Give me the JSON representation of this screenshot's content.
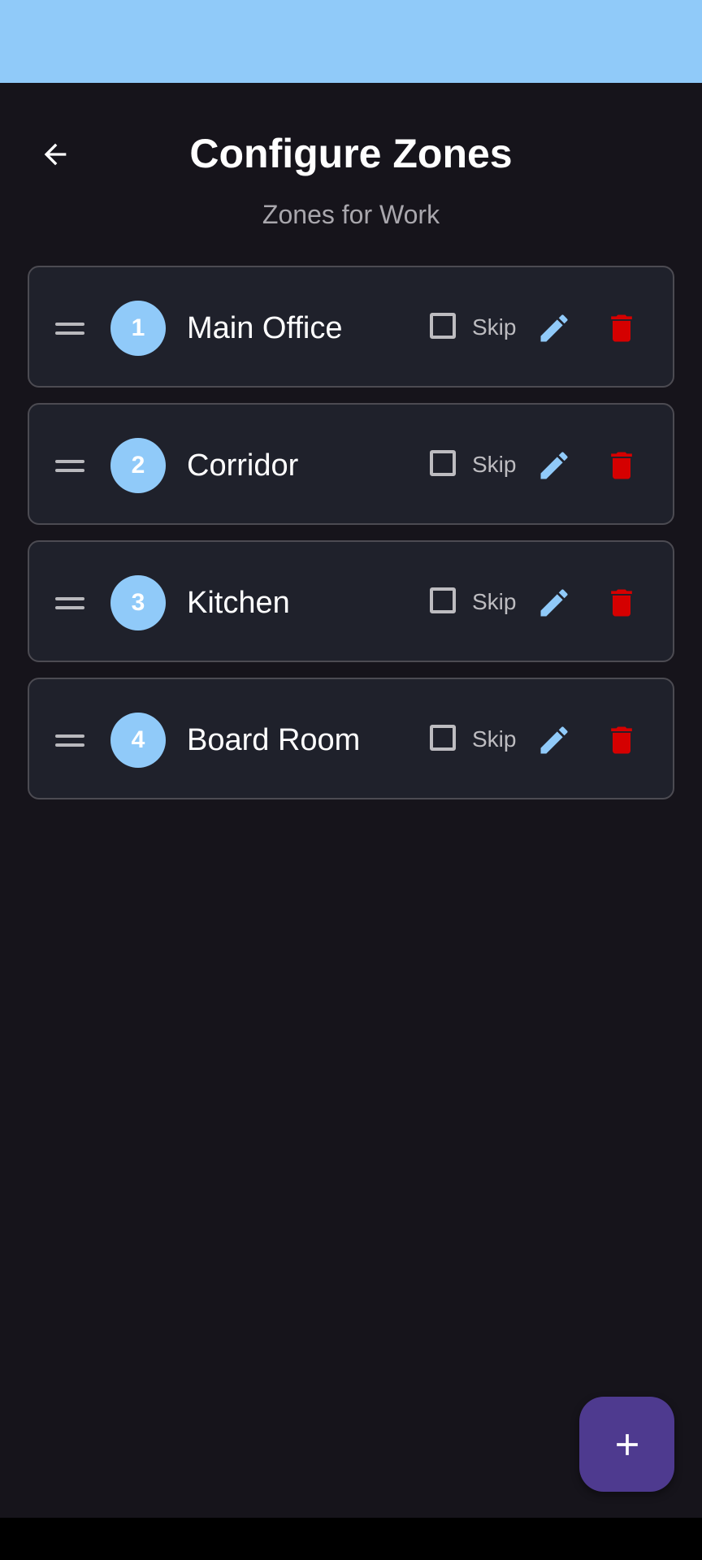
{
  "header": {
    "title": "Configure Zones",
    "subtitle": "Zones for Work",
    "back_icon": "arrow-left-icon"
  },
  "zones": [
    {
      "number": "1",
      "name": "Main Office",
      "skip_label": "Skip",
      "skip_checked": false
    },
    {
      "number": "2",
      "name": "Corridor",
      "skip_label": "Skip",
      "skip_checked": false
    },
    {
      "number": "3",
      "name": "Kitchen",
      "skip_label": "Skip",
      "skip_checked": false
    },
    {
      "number": "4",
      "name": "Board Room",
      "skip_label": "Skip",
      "skip_checked": false
    }
  ],
  "icons": {
    "drag": "drag-handle-icon",
    "edit": "pencil-icon",
    "delete": "trash-icon",
    "add": "plus-icon"
  },
  "colors": {
    "status_bar": "#90caf9",
    "background": "#16141b",
    "card": "#1f212b",
    "accent": "#90caf9",
    "delete": "#d50000",
    "fab": "#4e3a8f"
  }
}
